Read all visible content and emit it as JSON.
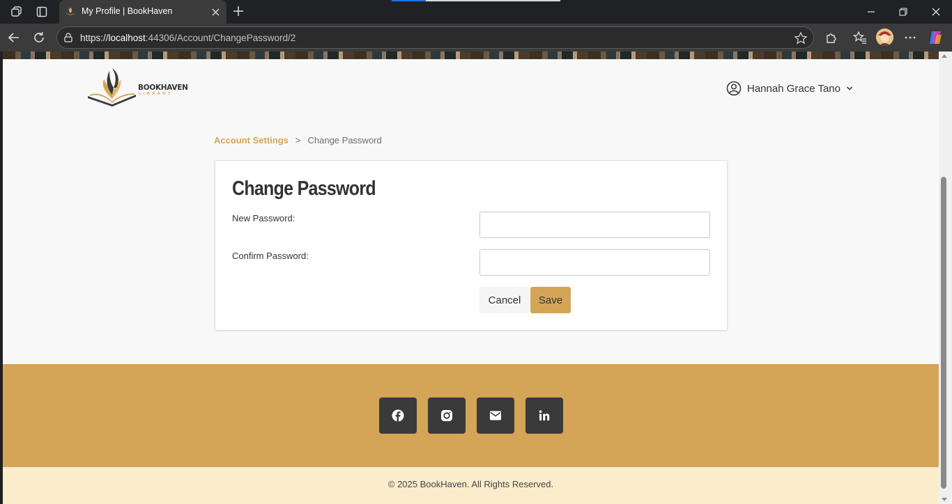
{
  "browser": {
    "tab_title": "My Profile | BookHaven",
    "url_protocol": "https://",
    "url_host": "localhost",
    "url_path": ":44306/Account/ChangePassword/2"
  },
  "header": {
    "logo_text": "BOOKHAVEN",
    "logo_subtext": "LIBRARY",
    "user_name": "Hannah Grace Tano"
  },
  "breadcrumb": {
    "parent": "Account Settings",
    "separator": ">",
    "current": "Change Password"
  },
  "form": {
    "title": "Change Password",
    "new_password_label": "New Password:",
    "new_password_value": "",
    "confirm_password_label": "Confirm Password:",
    "confirm_password_value": "",
    "cancel_label": "Cancel",
    "save_label": "Save"
  },
  "footer": {
    "social": [
      "facebook-icon",
      "instagram-icon",
      "email-icon",
      "linkedin-icon"
    ],
    "copyright": "© 2025 BookHaven. All Rights Reserved."
  },
  "colors": {
    "accent": "#d4a556",
    "footer_light": "#fbeccc",
    "social_button": "#3a3a3a",
    "text_dark": "#333333"
  }
}
